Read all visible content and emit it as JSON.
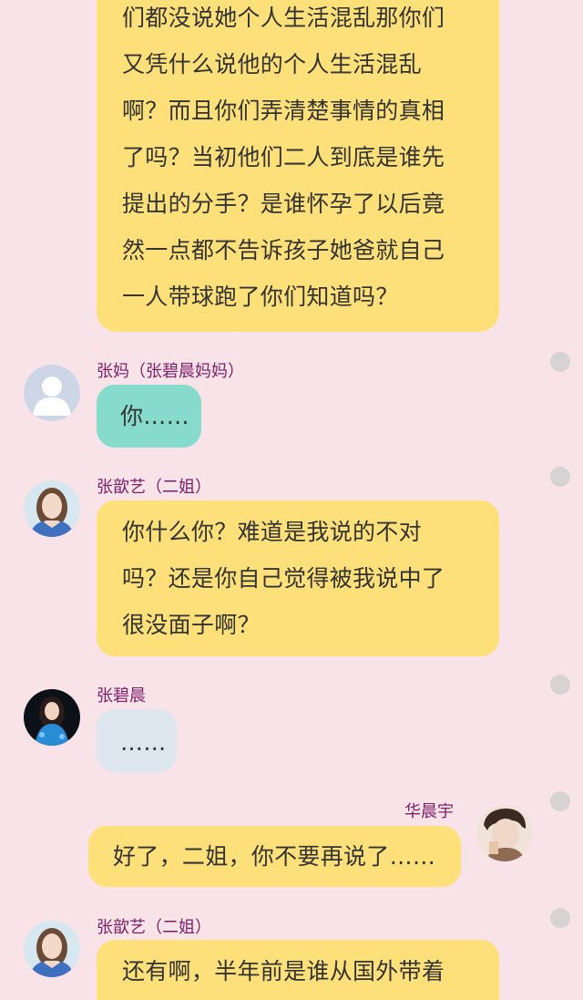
{
  "messages": [
    {
      "id": "m1",
      "sender": "",
      "text": "们都没说她个人生活混乱那你们\n又凭什么说他的个人生活混乱\n啊？而且你们弄清楚事情的真相\n了吗？当初他们二人到底是谁先\n提出的分手？是谁怀孕了以后竟\n然一点都不告诉孩子她爸就自己\n一人带球跑了你们知道吗？",
      "bubble_color": "#fde07a"
    },
    {
      "id": "m2",
      "sender": "张妈（张碧晨妈妈）",
      "text": "你……",
      "bubble_color": "#86dbcd",
      "avatar": "default-user-avatar"
    },
    {
      "id": "m3",
      "sender": "张歆艺（二姐）",
      "text": "你什么你？难道是我说的不对\n吗？还是你自己觉得被我说中了\n很没面子啊？",
      "bubble_color": "#fde07a",
      "avatar": "woman-portrait-avatar"
    },
    {
      "id": "m4",
      "sender": "张碧晨",
      "text": "……",
      "bubble_color": "#dde5ee",
      "avatar": "woman-blue-dress-avatar"
    },
    {
      "id": "m5",
      "sender": "华晨宇",
      "text": "好了，二姐，你不要再说了……",
      "bubble_color": "#fde07a",
      "avatar": "young-man-avatar"
    },
    {
      "id": "m6",
      "sender": "张歆艺（二姐）",
      "text": "还有啊，半年前是谁从国外带着",
      "bubble_color": "#fde07a",
      "avatar": "woman-portrait-avatar"
    }
  ],
  "colors": {
    "background": "#f8e3e8",
    "sender_name": "#7e1e66",
    "bubble_yellow": "#fde07a",
    "bubble_teal": "#86dbcd",
    "bubble_grey": "#dde5ee",
    "side_dot": "#d7d2d4"
  }
}
